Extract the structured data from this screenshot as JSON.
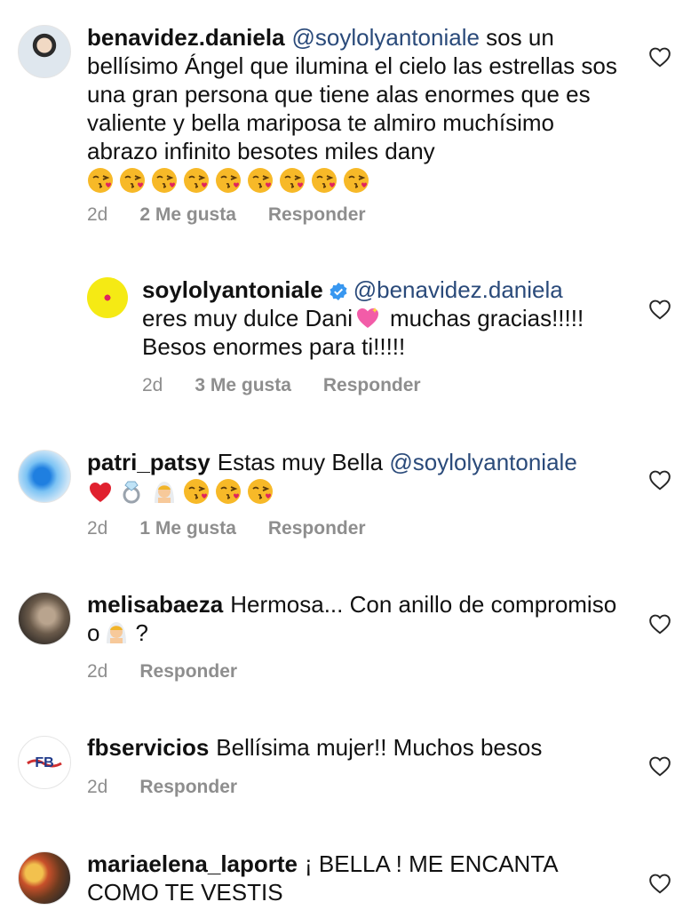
{
  "comments": [
    {
      "username": "benavidez.daniela",
      "mention": "@soylolyantoniale",
      "text": "sos un bellísimo Ángel que ilumina el cielo las estrellas sos una gran persona que tiene alas enormes que es valiente y bella mariposa te almiro muchísimo abrazo infinito besotes miles dany",
      "emojis": "😘😘😘😘😘😘😘😘😘",
      "time": "2d",
      "likes": "2 Me gusta",
      "reply": "Responder"
    },
    {
      "username": "soylolyantoniale",
      "mention": "@benavidez.daniela",
      "text_a": "eres muy dulce Dani",
      "text_b": "muchas gracias!!!!! Besos enormes para ti!!!!!",
      "time": "2d",
      "likes": "3 Me gusta",
      "reply": "Responder"
    },
    {
      "username": "patri_patsy",
      "text": "Estas muy Bella",
      "mention": "@soylolyantoniale",
      "time": "2d",
      "likes": "1 Me gusta",
      "reply": "Responder"
    },
    {
      "username": "melisabaeza",
      "text_a": "Hermosa... Con anillo de compromiso o",
      "text_b": "?",
      "time": "2d",
      "reply": "Responder"
    },
    {
      "username": "fbservicios",
      "text": "Bellísima mujer!! Muchos besos",
      "time": "2d",
      "reply": "Responder"
    },
    {
      "username": "mariaelena_laporte",
      "text": "¡ BELLA ! ME ENCANTA COMO TE VESTIS"
    }
  ],
  "icons": [
    "heart-outline-icon",
    "verified-badge-icon",
    "kiss-emoji-icon",
    "sparkling-heart-emoji-icon",
    "red-heart-emoji-icon",
    "ring-emoji-icon",
    "bride-emoji-icon"
  ]
}
